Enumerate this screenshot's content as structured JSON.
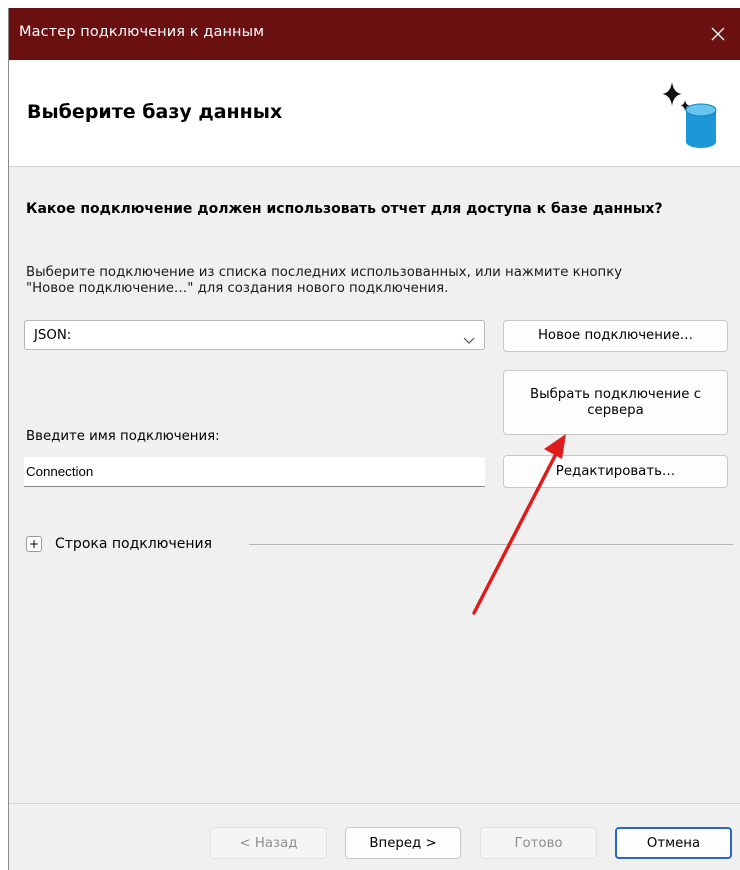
{
  "window": {
    "title": "Мастер подключения к данным",
    "titlebar_color": "#6b1010"
  },
  "header": {
    "page_title": "Выберите базу данных",
    "icon": "database-sparkle-icon"
  },
  "main": {
    "question": "Какое подключение должен использовать отчет для доступа к базе данных?",
    "hint_line1": "Выберите подключение из списка последних использованных, или нажмите кнопку",
    "hint_line2": "\"Новое подключение…\" для создания нового подключения.",
    "connection_select": {
      "value": "JSON:"
    },
    "new_connection_button": "Новое подключение…",
    "server_connection_button": "Выбрать подключение с сервера",
    "connection_name_label": "Введите имя подключения:",
    "connection_name_value": "Connection",
    "edit_button": "Редактировать…",
    "connection_string_label": "Строка подключения",
    "connection_string_expander": "+"
  },
  "footer": {
    "back_label": "< Назад",
    "next_label": "Вперед >",
    "finish_label": "Готово",
    "cancel_label": "Отмена"
  },
  "colors": {
    "accent": "#2a66c9",
    "annotation_arrow": "#e01b1b",
    "db_icon": "#1e97d8"
  }
}
